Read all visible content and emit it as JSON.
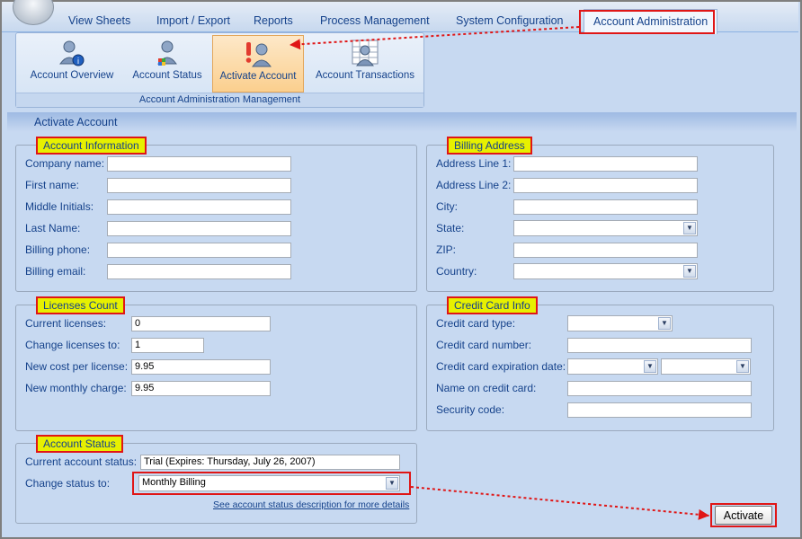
{
  "tabs": [
    "View Sheets",
    "Import / Export",
    "Reports",
    "Process Management",
    "System Configuration",
    "Account Administration"
  ],
  "ribbon": {
    "buttons": [
      {
        "label": "Account Overview",
        "icon": "user-info-icon"
      },
      {
        "label": "Account Status",
        "icon": "user-status-icon"
      },
      {
        "label": "Activate Account",
        "icon": "user-alert-icon"
      },
      {
        "label": "Account Transactions",
        "icon": "user-ledger-icon"
      }
    ],
    "group_label": "Account Administration Management"
  },
  "page_title": "Activate Account",
  "account_info": {
    "legend": "Account Information",
    "labels": [
      "Company name:",
      "First name:",
      "Middle Initials:",
      "Last Name:",
      "Billing phone:",
      "Billing email:"
    ],
    "values": [
      "",
      "",
      "",
      "",
      "",
      ""
    ]
  },
  "billing_address": {
    "legend": "Billing Address",
    "labels": [
      "Address Line 1:",
      "Address Line 2:",
      "City:",
      "State:",
      "ZIP:",
      "Country:"
    ],
    "values": [
      "",
      "",
      "",
      "",
      "",
      ""
    ]
  },
  "licenses": {
    "legend": "Licenses Count",
    "labels": [
      "Current licenses:",
      "Change licenses to:",
      "New cost per license:",
      "New monthly charge:"
    ],
    "values": [
      "0",
      "1",
      "9.95",
      "9.95"
    ]
  },
  "credit_card": {
    "legend": "Credit Card Info",
    "labels": [
      "Credit card type:",
      "Credit card number:",
      "Credit card expiration date:",
      "Name on credit card:",
      "Security code:"
    ],
    "values": [
      "",
      "",
      "",
      "",
      ""
    ]
  },
  "account_status": {
    "legend": "Account Status",
    "current_label": "Current account status:",
    "current_value": "Trial (Expires: Thursday, July 26, 2007)",
    "change_label": "Change status to:",
    "change_value": "Monthly Billing",
    "link": "See account status description for more details"
  },
  "activate_button": "Activate",
  "colors": {
    "accent_red": "#e01616",
    "legend_yellow": "#e7f000",
    "text_blue": "#15428b"
  }
}
